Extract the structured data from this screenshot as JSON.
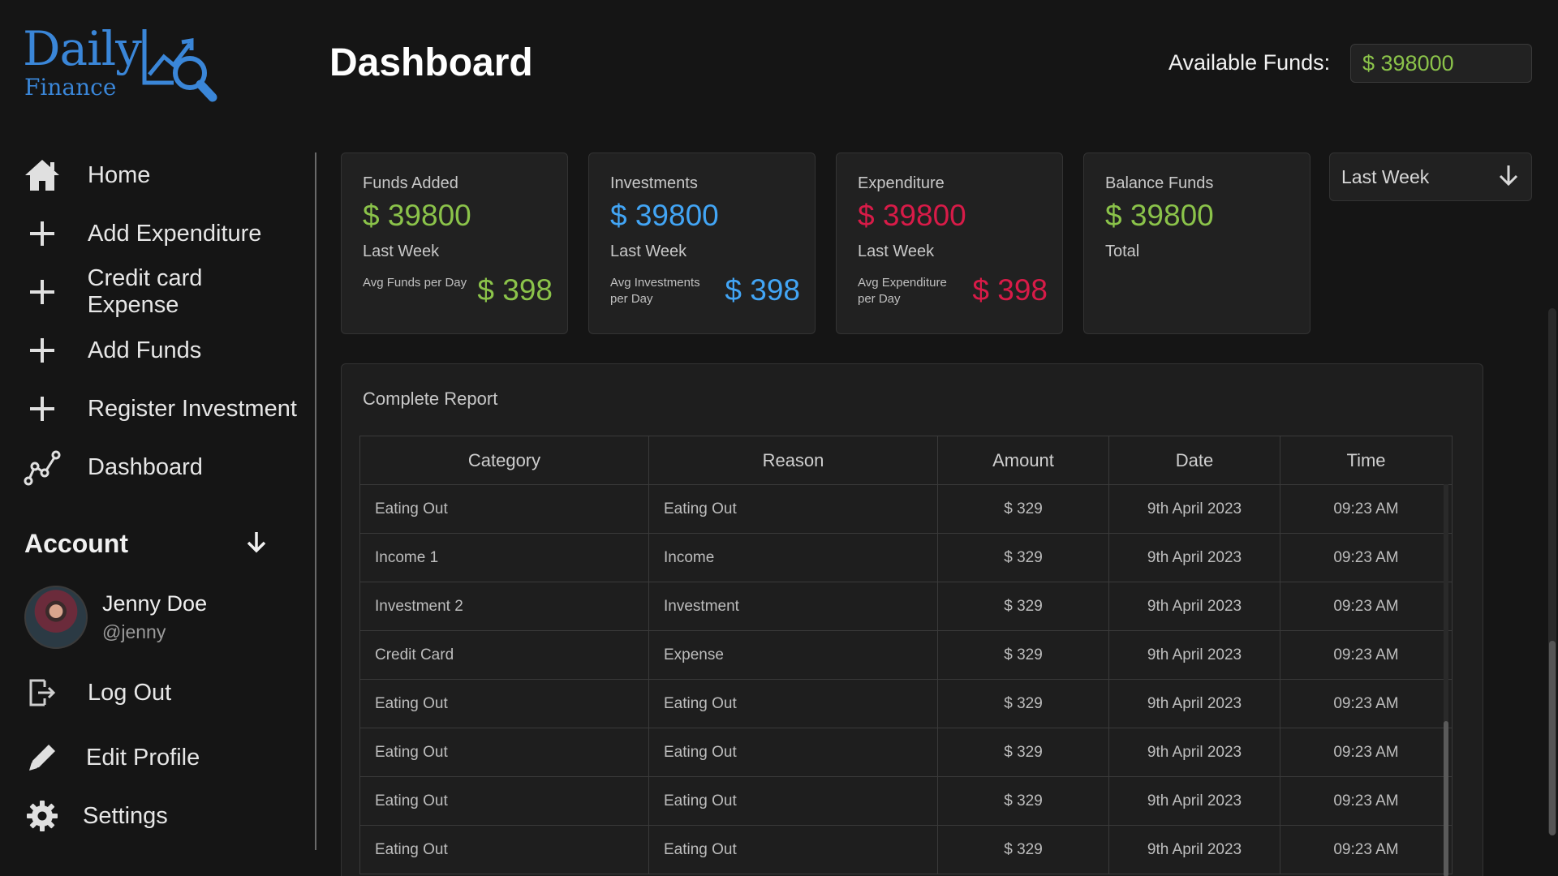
{
  "brand": {
    "word": "Daily",
    "sub": "Finance"
  },
  "header": {
    "title": "Dashboard",
    "funds_label": "Available Funds:",
    "funds_value": "$ 398000"
  },
  "nav": {
    "items": [
      {
        "label": "Home",
        "icon": "home-icon"
      },
      {
        "label": "Add Expenditure",
        "icon": "plus-icon"
      },
      {
        "label": "Credit card Expense",
        "icon": "plus-icon"
      },
      {
        "label": "Add Funds",
        "icon": "plus-icon"
      },
      {
        "label": "Register Investment",
        "icon": "plus-icon"
      },
      {
        "label": "Dashboard",
        "icon": "chart-line-icon"
      }
    ]
  },
  "account": {
    "heading": "Account",
    "name": "Jenny Doe",
    "handle": "@jenny",
    "logout": "Log Out",
    "edit_profile": "Edit Profile",
    "settings": "Settings"
  },
  "cards": [
    {
      "title": "Funds Added",
      "value": "$ 39800",
      "period": "Last Week",
      "avg_label": "Avg Funds per Day",
      "avg_value": "$ 398",
      "color": "#8bc34a"
    },
    {
      "title": "Investments",
      "value": "$ 39800",
      "period": "Last Week",
      "avg_label": "Avg Investments per Day",
      "avg_value": "$ 398",
      "color": "#42a5f5"
    },
    {
      "title": "Expenditure",
      "value": "$ 39800",
      "period": "Last Week",
      "avg_label": "Avg Expenditure per Day",
      "avg_value": "$ 398",
      "color": "#d81b48"
    },
    {
      "title": "Balance Funds",
      "value": "$ 39800",
      "period": "Total",
      "color": "#8bc34a"
    }
  ],
  "period_select": {
    "value": "Last Week"
  },
  "report": {
    "title": "Complete Report",
    "columns": [
      "Category",
      "Reason",
      "Amount",
      "Date",
      "Time"
    ],
    "rows": [
      [
        "Eating Out",
        "Eating Out",
        "$ 329",
        "9th April 2023",
        "09:23 AM"
      ],
      [
        "Income 1",
        "Income",
        "$ 329",
        "9th April 2023",
        "09:23 AM"
      ],
      [
        "Investment 2",
        "Investment",
        "$ 329",
        "9th April 2023",
        "09:23 AM"
      ],
      [
        "Credit Card",
        "Expense",
        "$ 329",
        "9th April 2023",
        "09:23 AM"
      ],
      [
        "Eating Out",
        "Eating Out",
        "$ 329",
        "9th April 2023",
        "09:23 AM"
      ],
      [
        "Eating Out",
        "Eating Out",
        "$ 329",
        "9th April 2023",
        "09:23 AM"
      ],
      [
        "Eating Out",
        "Eating Out",
        "$ 329",
        "9th April 2023",
        "09:23 AM"
      ],
      [
        "Eating Out",
        "Eating Out",
        "$ 329",
        "9th April 2023",
        "09:23 AM"
      ]
    ]
  },
  "colors": {
    "accent_green": "#8bc34a",
    "accent_blue": "#42a5f5",
    "accent_red": "#d81b48",
    "brand_blue": "#3a86d8"
  }
}
